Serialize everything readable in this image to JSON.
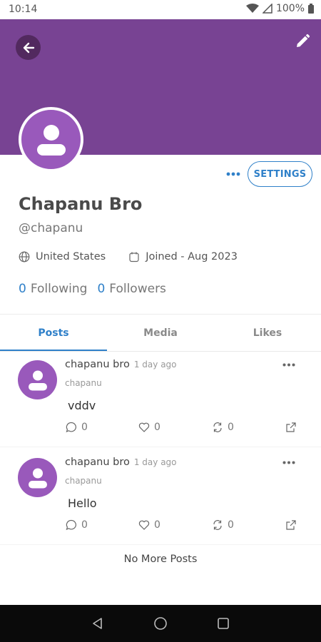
{
  "status_bar": {
    "time": "10:14",
    "battery": "100%"
  },
  "profile": {
    "name": "Chapanu Bro",
    "handle": "@chapanu",
    "location": "United States",
    "joined": "Joined - Aug 2023",
    "following_count": "0",
    "following_label": "Following",
    "followers_count": "0",
    "followers_label": "Followers",
    "settings_label": "SETTINGS"
  },
  "colors": {
    "banner": "#784393",
    "accent": "#2f80c9",
    "avatar": "#9959bb"
  },
  "tabs": [
    {
      "label": "Posts",
      "active": true
    },
    {
      "label": "Media",
      "active": false
    },
    {
      "label": "Likes",
      "active": false
    }
  ],
  "posts": [
    {
      "author": "chapanu bro",
      "time": "1 day ago",
      "handle": "chapanu",
      "text": "vddv",
      "replies": "0",
      "likes": "0",
      "reposts": "0"
    },
    {
      "author": "chapanu bro",
      "time": "1 day ago",
      "handle": "chapanu",
      "text": "Hello",
      "replies": "0",
      "likes": "0",
      "reposts": "0"
    }
  ],
  "feed_end": "No More Posts",
  "icons": {
    "back": "arrow-left-icon",
    "edit": "pencil-icon",
    "more": "more-horizontal-icon",
    "location": "globe-icon",
    "joined": "calendar-icon",
    "reply": "comment-icon",
    "like": "heart-icon",
    "repost": "repost-icon",
    "share": "share-icon"
  }
}
